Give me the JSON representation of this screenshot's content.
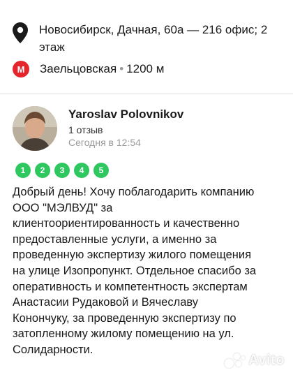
{
  "location": {
    "address": "Новосибирск, Дачная, 60а — 216 офис; 2 этаж",
    "metro_letter": "M",
    "metro_station": "Заельцовская",
    "metro_separator": "•",
    "metro_distance": "1200 м",
    "metro_color": "#e5252b"
  },
  "review": {
    "author": "Yaroslav Polovnikov",
    "reviews_count": "1 отзыв",
    "date": "Сегодня в 12:54",
    "rating": {
      "value": 5,
      "max": 5,
      "labels": [
        "1",
        "2",
        "3",
        "4",
        "5"
      ],
      "color": "#2fc75f"
    },
    "text_lines": [
      "Добрый день! Хочу поблагодарить компанию",
      "ООО \"МЭЛВУД\" за",
      "клиентоориентированность и качественно",
      "предоставленные услуги, а именно за",
      "проведенную экспертизу жилого помещения",
      "на улице Изопропункт. Отдельное спасибо за",
      "оперативность и компетентность экспертам",
      "Анастасии Рудаковой и Вячеславу",
      "Конончуку, за проведенную экспертизу по",
      "затопленному жилому помещению на ул.",
      "Солидарности."
    ]
  },
  "watermark": {
    "text": "Avito"
  }
}
